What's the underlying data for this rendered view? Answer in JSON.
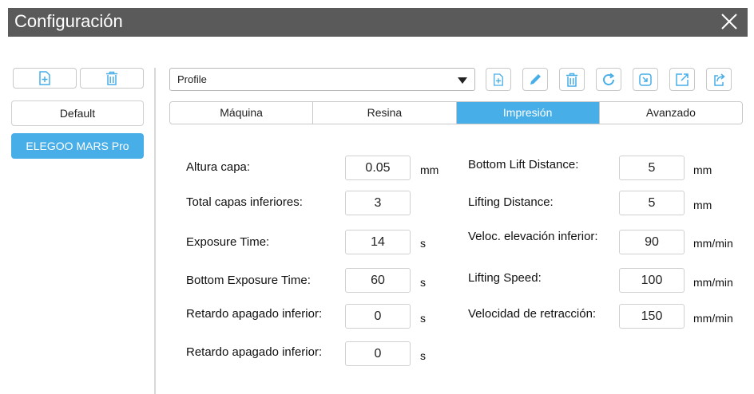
{
  "window": {
    "title": "Configuración",
    "close_icon": "close-icon"
  },
  "left_panel": {
    "add_icon": "add-file-icon",
    "delete_icon": "trash-icon",
    "profiles": [
      "Default",
      "ELEGOO MARS Pro"
    ],
    "selected_profile": "ELEGOO MARS Pro"
  },
  "toolbar": {
    "profile_select": {
      "value": "Profile"
    },
    "icons": [
      "add-file-icon",
      "pencil-icon",
      "trash-icon",
      "refresh-icon",
      "import-icon",
      "export-icon",
      "export-all-icon"
    ]
  },
  "tabs": [
    {
      "label": "Máquina",
      "active": false
    },
    {
      "label": "Resina",
      "active": false
    },
    {
      "label": "Impresión",
      "active": true
    },
    {
      "label": "Avanzado",
      "active": false
    }
  ],
  "params_left": [
    {
      "label": "Altura capa:",
      "value": "0.05",
      "unit": "mm"
    },
    {
      "label": "Total capas inferiores:",
      "value": "3",
      "unit": ""
    },
    {
      "label": "Exposure Time:",
      "value": "14",
      "unit": "s"
    },
    {
      "label": "Bottom Exposure Time:",
      "value": "60",
      "unit": "s"
    },
    {
      "label": "Retardo apagado inferior:",
      "value": "0",
      "unit": "s"
    },
    {
      "label": "Retardo apagado inferior:",
      "value": "0",
      "unit": "s"
    }
  ],
  "params_right": [
    {
      "label": "Bottom Lift Distance:",
      "value": "5",
      "unit": "mm"
    },
    {
      "label": "Lifting Distance:",
      "value": "5",
      "unit": "mm"
    },
    {
      "label": "Veloc. elevación inferior:",
      "value": "90",
      "unit": "mm/min"
    },
    {
      "label": "Lifting Speed:",
      "value": "100",
      "unit": "mm/min"
    },
    {
      "label": "Velocidad de retracción:",
      "value": "150",
      "unit": "mm/min"
    }
  ],
  "colors": {
    "accent": "#48aee8",
    "titlebar": "#5a5a5a",
    "icon": "#48aee8"
  }
}
